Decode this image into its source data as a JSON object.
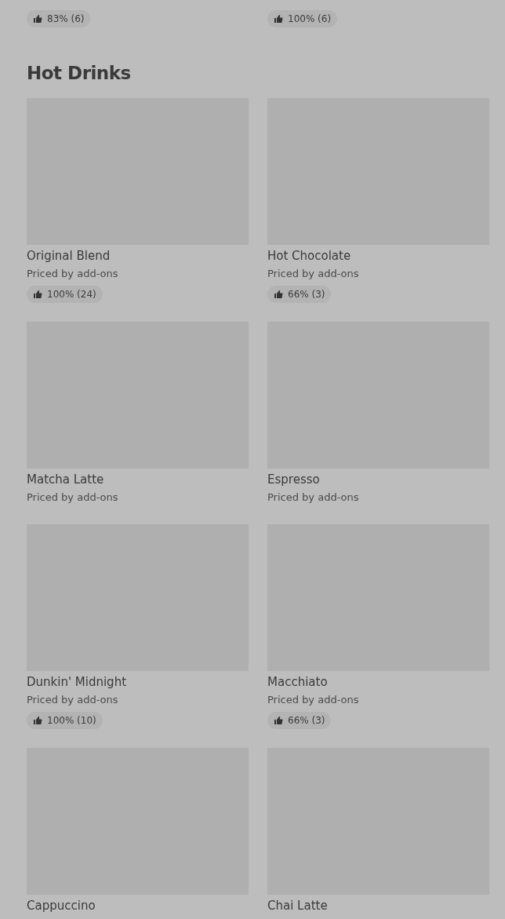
{
  "previous_section": {
    "ratings": [
      "83% (6)",
      "100% (6)"
    ]
  },
  "section": {
    "title": "Hot Drinks",
    "items": [
      {
        "name": "Original Blend",
        "subtitle": "Priced by add-ons",
        "rating": "100% (24)"
      },
      {
        "name": "Hot Chocolate",
        "subtitle": "Priced by add-ons",
        "rating": "66% (3)"
      },
      {
        "name": "Matcha Latte",
        "subtitle": "Priced by add-ons"
      },
      {
        "name": "Espresso",
        "subtitle": "Priced by add-ons"
      },
      {
        "name": "Dunkin' Midnight",
        "subtitle": "Priced by add-ons",
        "rating": "100% (10)"
      },
      {
        "name": "Macchiato",
        "subtitle": "Priced by add-ons",
        "rating": "66% (3)"
      },
      {
        "name": "Cappuccino"
      },
      {
        "name": "Chai Latte"
      }
    ]
  }
}
